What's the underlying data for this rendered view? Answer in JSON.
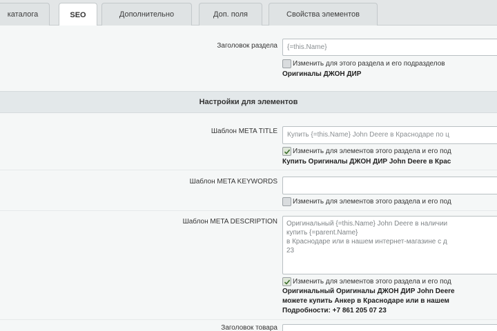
{
  "tabs": [
    {
      "label": "каталога",
      "active": false
    },
    {
      "label": "SEO",
      "active": true
    },
    {
      "label": "Дополнительно",
      "active": false
    },
    {
      "label": "Доп. поля",
      "active": false
    },
    {
      "label": "Свойства элементов",
      "active": false
    }
  ],
  "section": {
    "title_label": "Заголовок раздела",
    "title_value": "{=this.Name}",
    "title_checkbox": "Изменить для этого раздела и его подразделов",
    "title_checked": false,
    "title_preview": "Оригиналы ДЖОН ДИР"
  },
  "elements_header": "Настройки для элементов",
  "meta_title": {
    "label": "Шаблон META TITLE",
    "value": "Купить {=this.Name} John Deere в Краснодаре по ц",
    "checkbox": "Изменить для элементов этого раздела и его под",
    "checked": true,
    "preview": "Купить Оригиналы ДЖОН ДИР John Deere в Крас"
  },
  "meta_keywords": {
    "label": "Шаблон META KEYWORDS",
    "value": "",
    "checkbox": "Изменить для элементов этого раздела и его под",
    "checked": false
  },
  "meta_description": {
    "label": "Шаблон META DESCRIPTION",
    "lines": [
      "Оригинальный {=this.Name} John Deere в наличии",
      "купить {=parent.Name}",
      "в Краснодаре или в нашем интернет-магазине  с д",
      "23"
    ],
    "checkbox": "Изменить для элементов этого раздела и его под",
    "checked": true,
    "preview_lines": [
      "Оригинальный Оригиналы ДЖОН ДИР John Deere",
      "можете купить Анкер в Краснодаре или в нашем",
      "Подробности: +7 861 205 07 23"
    ]
  },
  "product_title": {
    "label": "Заголовок товара"
  }
}
